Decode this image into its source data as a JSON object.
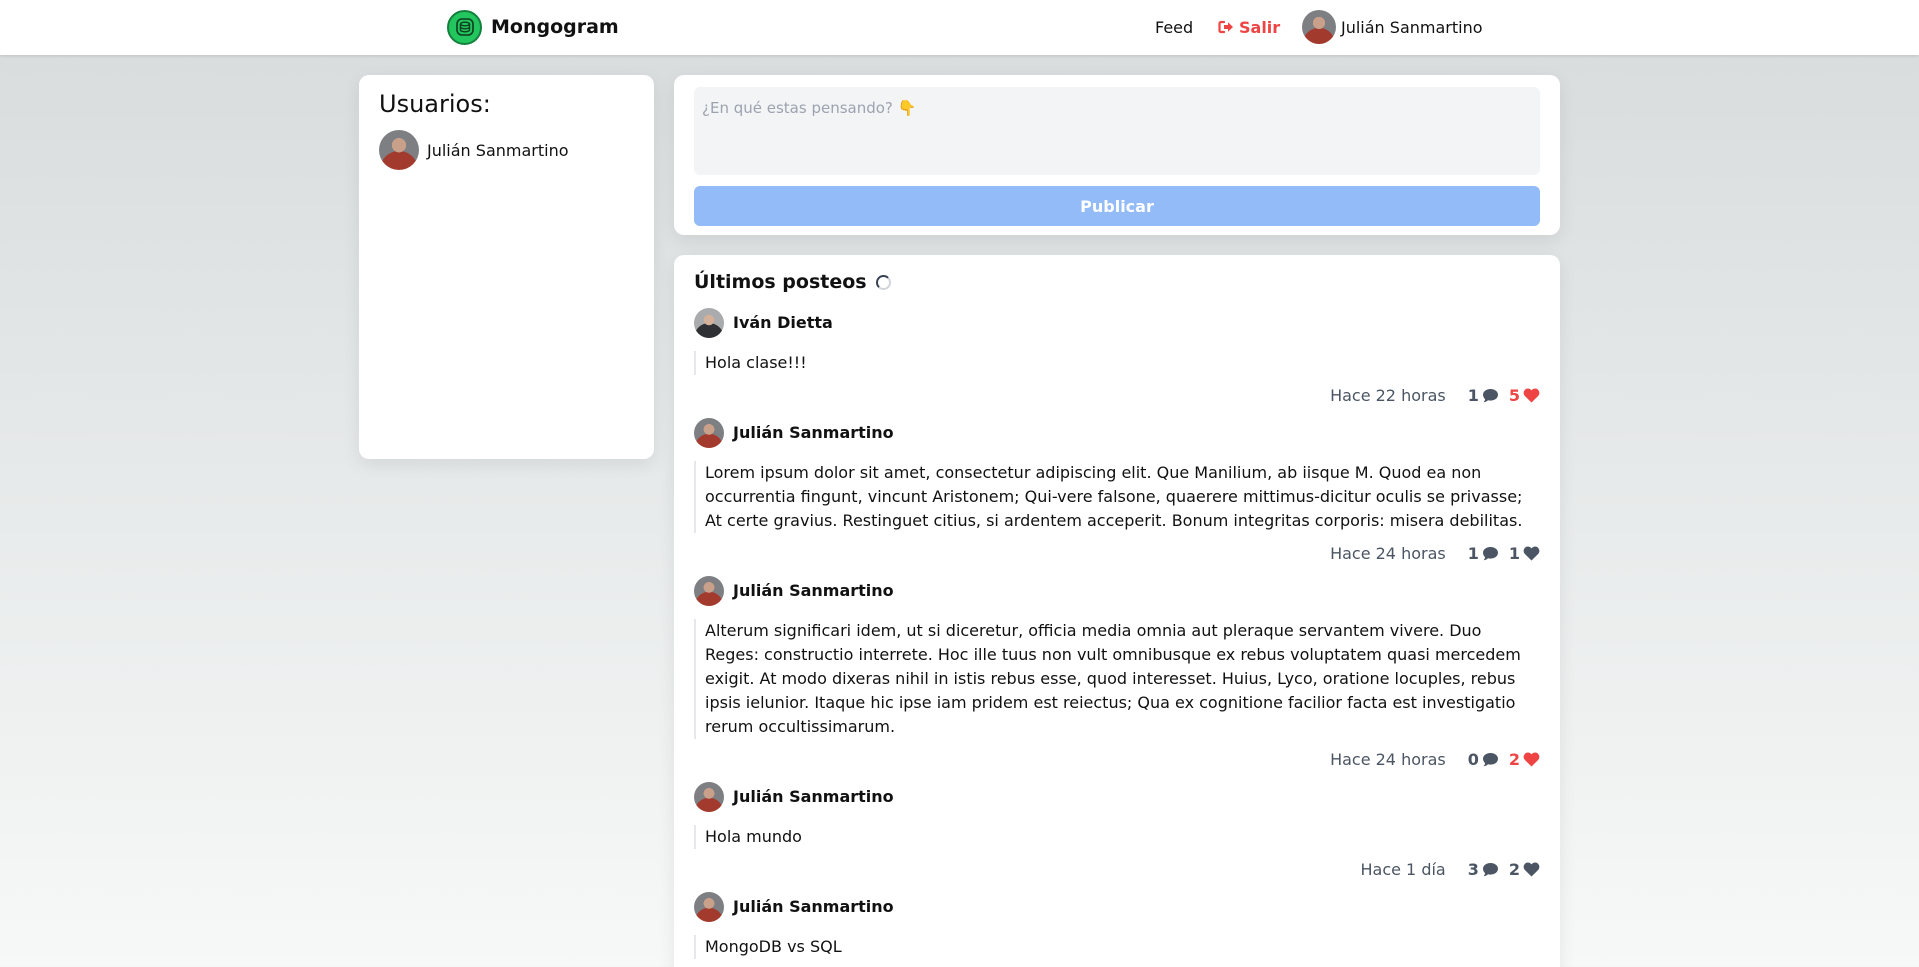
{
  "nav": {
    "brand": "Mongogram",
    "feed_label": "Feed",
    "logout_label": "Salir",
    "user_name": "Julián Sanmartino"
  },
  "sidebar": {
    "title": "Usuarios:",
    "users": [
      {
        "name": "Julián Sanmartino"
      }
    ]
  },
  "composer": {
    "placeholder": "¿En qué estas pensando? 👇",
    "publish_label": "Publicar"
  },
  "feed": {
    "title": "Últimos posteos",
    "posts": [
      {
        "author": "Iván Dietta",
        "body": "Hola clase!!!",
        "time": "Hace 22 horas",
        "comments": "1",
        "likes": "5",
        "liked": true
      },
      {
        "author": "Julián Sanmartino",
        "body": "Lorem ipsum dolor sit amet, consectetur adipiscing elit. Que Manilium, ab iisque M. Quod ea non occurrentia fingunt, vincunt Aristonem; Qui-vere falsone, quaerere mittimus-dicitur oculis se privasse; At certe gravius. Restinguet citius, si ardentem acceperit. Bonum integritas corporis: misera debilitas.",
        "time": "Hace 24 horas",
        "comments": "1",
        "likes": "1",
        "liked": false
      },
      {
        "author": "Julián Sanmartino",
        "body": "Alterum significari idem, ut si diceretur, officia media omnia aut pleraque servantem vivere. Duo Reges: constructio interrete. Hoc ille tuus non vult omnibusque ex rebus voluptatem quasi mercedem exigit. At modo dixeras nihil in istis rebus esse, quod interesset. Huius, Lyco, oratione locuples, rebus ipsis ielunior. Itaque hic ipse iam pridem est reiectus; Qua ex cognitione facilior facta est investigatio rerum occultissimarum.",
        "time": "Hace 24 horas",
        "comments": "0",
        "likes": "2",
        "liked": true
      },
      {
        "author": "Julián Sanmartino",
        "body": "Hola mundo",
        "time": "Hace 1 día",
        "comments": "3",
        "likes": "2",
        "liked": false
      },
      {
        "author": "Julián Sanmartino",
        "body": "MongoDB vs SQL",
        "time": "",
        "comments": "",
        "likes": "",
        "liked": false
      }
    ]
  },
  "colors": {
    "brand_green": "#22c55e",
    "logout_red": "#ef4444",
    "publish_blue": "#93bbf7",
    "like_red": "#ef4444",
    "meta_gray": "#4b5563"
  }
}
